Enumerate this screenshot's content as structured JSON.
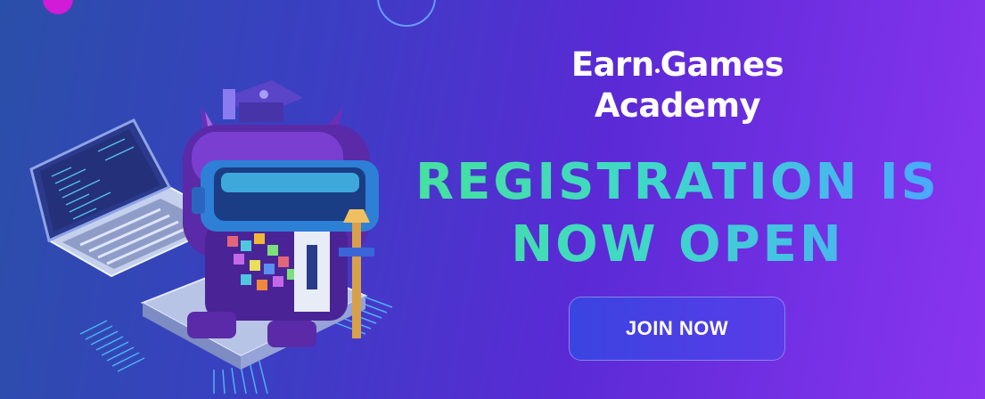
{
  "brand": {
    "name_line1_part1": "Earn",
    "name_line1_part2": "Games",
    "name_line2": "Academy"
  },
  "headline": {
    "line1": "REGISTRATION IS",
    "line2": "NOW OPEN"
  },
  "cta": {
    "label": "JOIN NOW"
  },
  "colors": {
    "background_start": "#2a4fa8",
    "background_end": "#8a35f0",
    "headline_green": "#46e0a0",
    "headline_blue": "#4aa8ff",
    "button": "#3a44e0",
    "accent_pink": "#d21bd6"
  },
  "illustration": {
    "icons": [
      "laptop-icon",
      "pixel-cat-mascot-icon",
      "vr-headset-icon",
      "graduation-cap-icon",
      "circuit-chip-icon"
    ]
  }
}
